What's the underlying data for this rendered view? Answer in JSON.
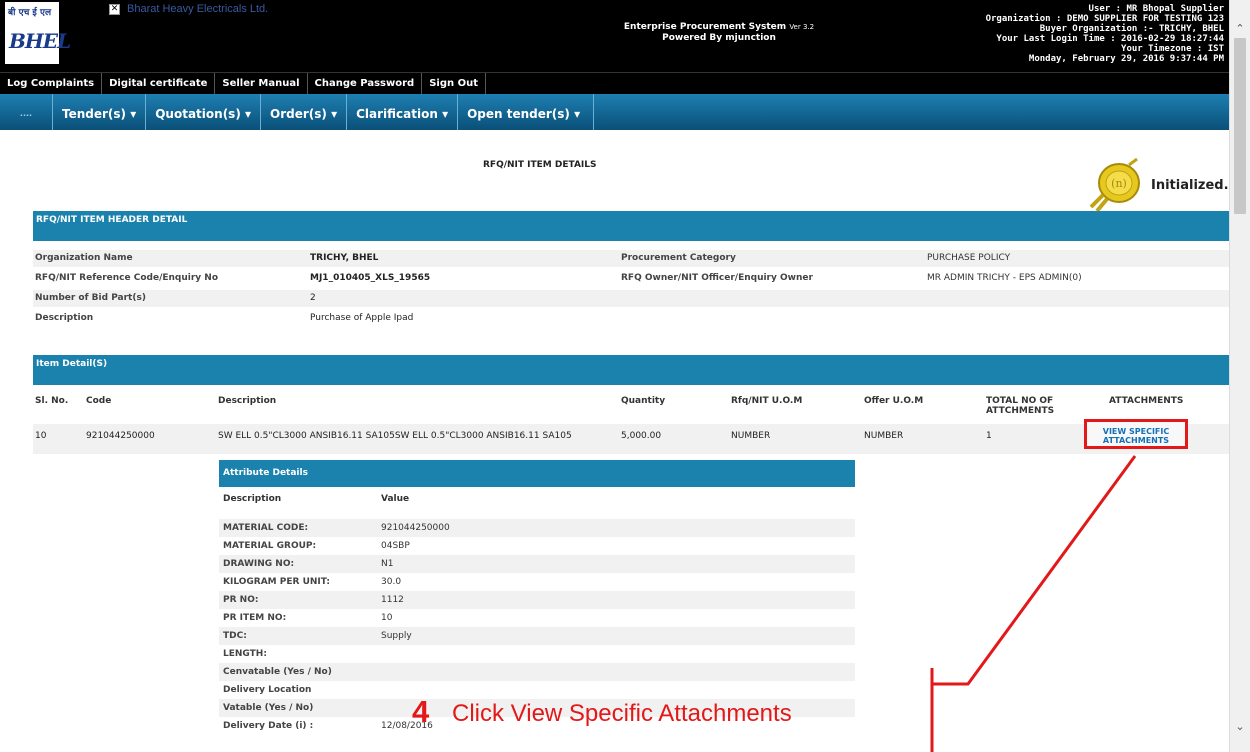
{
  "header": {
    "logo_hindi": "बी एच ई एल",
    "logo_text": "BHEL",
    "company": "Bharat Heavy Electricals Ltd.",
    "broken_image_glyph": "✕",
    "system_name": "Enterprise Procurement System",
    "version": "Ver 3.2",
    "powered_by": "Powered By mjunction",
    "user_lines": [
      "User : MR Bhopal Supplier",
      "Organization : DEMO SUPPLIER FOR TESTING 123",
      "Buyer Organization :- TRICHY, BHEL",
      "Your Last Login Time : 2016-02-29 18:27:44",
      "Your Timezone : IST",
      "Monday, February 29, 2016  9:37:44 PM"
    ]
  },
  "links": [
    "Log Complaints",
    "Digital certificate",
    "Seller Manual",
    "Change Password",
    "Sign Out"
  ],
  "menu": {
    "dots": "....",
    "items": [
      "Tender(s) ▾",
      "Quotation(s) ▾",
      "Order(s) ▾",
      "Clarification ▾",
      "Open tender(s) ▾"
    ]
  },
  "page": {
    "title": "RFQ/NIT ITEM DETAILS",
    "status": "Initialized...",
    "header_section": "RFQ/NIT ITEM HEADER DETAIL",
    "header_rows": [
      {
        "l1": "Organization Name",
        "v1": "TRICHY, BHEL",
        "l2": "Procurement Category",
        "v2": "PURCHASE POLICY"
      },
      {
        "l1": "RFQ/NIT Reference Code/Enquiry No",
        "v1": "MJ1_010405_XLS_19565",
        "l2": "RFQ Owner/NIT Officer/Enquiry Owner",
        "v2": "MR ADMIN TRICHY - EPS ADMIN(0)"
      },
      {
        "l1": "Number of Bid Part(s)",
        "v1": "2",
        "l2": "",
        "v2": ""
      },
      {
        "l1": "Description",
        "v1": "Purchase of Apple Ipad",
        "l2": "",
        "v2": ""
      }
    ],
    "item_section": "Item Detail(S)",
    "item_columns": [
      "Sl. No.",
      "Code",
      "Description",
      "Quantity",
      "Rfq/NIT U.O.M",
      "Offer U.O.M",
      "TOTAL NO OF ATTCHMENTS",
      "ATTACHMENTS"
    ],
    "item_row": {
      "sl": "10",
      "code": "921044250000",
      "description": "SW ELL 0.5\"CL3000 ANSIB16.11 SA105SW ELL 0.5\"CL3000 ANSIB16.11 SA105",
      "quantity": "5,000.00",
      "rfq_uom": "NUMBER",
      "offer_uom": "NUMBER",
      "total_attachments": "1",
      "link": "VIEW SPECIFIC ATTACHMENTS"
    },
    "attributes": {
      "heading": "Attribute Details",
      "col_desc": "Description",
      "col_value": "Value",
      "rows": [
        {
          "k": "MATERIAL CODE:",
          "v": "921044250000"
        },
        {
          "k": "MATERIAL GROUP:",
          "v": "04SBP"
        },
        {
          "k": "DRAWING NO:",
          "v": "N1"
        },
        {
          "k": "KILOGRAM PER UNIT:",
          "v": "30.0"
        },
        {
          "k": "PR NO:",
          "v": "1112"
        },
        {
          "k": "PR ITEM NO:",
          "v": "10"
        },
        {
          "k": "TDC:",
          "v": "Supply"
        },
        {
          "k": "LENGTH:",
          "v": ""
        },
        {
          "k": "Cenvatable (Yes / No)",
          "v": ""
        },
        {
          "k": "Delivery Location",
          "v": ""
        },
        {
          "k": "Vatable (Yes / No)",
          "v": ""
        },
        {
          "k": "Delivery Date (i) :",
          "v": "12/08/2016"
        }
      ]
    }
  },
  "annotation": {
    "number": "4",
    "text": "Click View Specific Attachments",
    "color": "#e31818"
  },
  "scrollbar": {
    "up": "⌃",
    "down": "⌄"
  }
}
